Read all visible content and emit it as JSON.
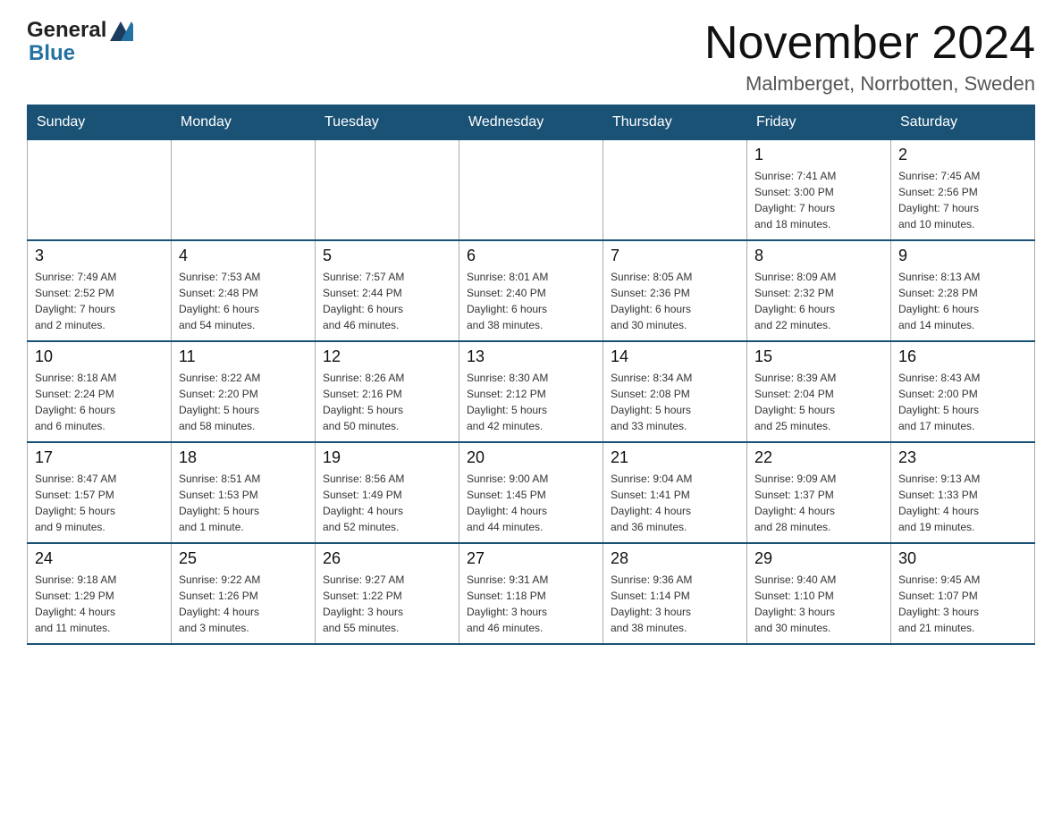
{
  "header": {
    "month_year": "November 2024",
    "location": "Malmberget, Norrbotten, Sweden",
    "logo_general": "General",
    "logo_blue": "Blue"
  },
  "weekdays": [
    "Sunday",
    "Monday",
    "Tuesday",
    "Wednesday",
    "Thursday",
    "Friday",
    "Saturday"
  ],
  "weeks": [
    {
      "days": [
        {
          "date": "",
          "info": ""
        },
        {
          "date": "",
          "info": ""
        },
        {
          "date": "",
          "info": ""
        },
        {
          "date": "",
          "info": ""
        },
        {
          "date": "",
          "info": ""
        },
        {
          "date": "1",
          "info": "Sunrise: 7:41 AM\nSunset: 3:00 PM\nDaylight: 7 hours\nand 18 minutes."
        },
        {
          "date": "2",
          "info": "Sunrise: 7:45 AM\nSunset: 2:56 PM\nDaylight: 7 hours\nand 10 minutes."
        }
      ]
    },
    {
      "days": [
        {
          "date": "3",
          "info": "Sunrise: 7:49 AM\nSunset: 2:52 PM\nDaylight: 7 hours\nand 2 minutes."
        },
        {
          "date": "4",
          "info": "Sunrise: 7:53 AM\nSunset: 2:48 PM\nDaylight: 6 hours\nand 54 minutes."
        },
        {
          "date": "5",
          "info": "Sunrise: 7:57 AM\nSunset: 2:44 PM\nDaylight: 6 hours\nand 46 minutes."
        },
        {
          "date": "6",
          "info": "Sunrise: 8:01 AM\nSunset: 2:40 PM\nDaylight: 6 hours\nand 38 minutes."
        },
        {
          "date": "7",
          "info": "Sunrise: 8:05 AM\nSunset: 2:36 PM\nDaylight: 6 hours\nand 30 minutes."
        },
        {
          "date": "8",
          "info": "Sunrise: 8:09 AM\nSunset: 2:32 PM\nDaylight: 6 hours\nand 22 minutes."
        },
        {
          "date": "9",
          "info": "Sunrise: 8:13 AM\nSunset: 2:28 PM\nDaylight: 6 hours\nand 14 minutes."
        }
      ]
    },
    {
      "days": [
        {
          "date": "10",
          "info": "Sunrise: 8:18 AM\nSunset: 2:24 PM\nDaylight: 6 hours\nand 6 minutes."
        },
        {
          "date": "11",
          "info": "Sunrise: 8:22 AM\nSunset: 2:20 PM\nDaylight: 5 hours\nand 58 minutes."
        },
        {
          "date": "12",
          "info": "Sunrise: 8:26 AM\nSunset: 2:16 PM\nDaylight: 5 hours\nand 50 minutes."
        },
        {
          "date": "13",
          "info": "Sunrise: 8:30 AM\nSunset: 2:12 PM\nDaylight: 5 hours\nand 42 minutes."
        },
        {
          "date": "14",
          "info": "Sunrise: 8:34 AM\nSunset: 2:08 PM\nDaylight: 5 hours\nand 33 minutes."
        },
        {
          "date": "15",
          "info": "Sunrise: 8:39 AM\nSunset: 2:04 PM\nDaylight: 5 hours\nand 25 minutes."
        },
        {
          "date": "16",
          "info": "Sunrise: 8:43 AM\nSunset: 2:00 PM\nDaylight: 5 hours\nand 17 minutes."
        }
      ]
    },
    {
      "days": [
        {
          "date": "17",
          "info": "Sunrise: 8:47 AM\nSunset: 1:57 PM\nDaylight: 5 hours\nand 9 minutes."
        },
        {
          "date": "18",
          "info": "Sunrise: 8:51 AM\nSunset: 1:53 PM\nDaylight: 5 hours\nand 1 minute."
        },
        {
          "date": "19",
          "info": "Sunrise: 8:56 AM\nSunset: 1:49 PM\nDaylight: 4 hours\nand 52 minutes."
        },
        {
          "date": "20",
          "info": "Sunrise: 9:00 AM\nSunset: 1:45 PM\nDaylight: 4 hours\nand 44 minutes."
        },
        {
          "date": "21",
          "info": "Sunrise: 9:04 AM\nSunset: 1:41 PM\nDaylight: 4 hours\nand 36 minutes."
        },
        {
          "date": "22",
          "info": "Sunrise: 9:09 AM\nSunset: 1:37 PM\nDaylight: 4 hours\nand 28 minutes."
        },
        {
          "date": "23",
          "info": "Sunrise: 9:13 AM\nSunset: 1:33 PM\nDaylight: 4 hours\nand 19 minutes."
        }
      ]
    },
    {
      "days": [
        {
          "date": "24",
          "info": "Sunrise: 9:18 AM\nSunset: 1:29 PM\nDaylight: 4 hours\nand 11 minutes."
        },
        {
          "date": "25",
          "info": "Sunrise: 9:22 AM\nSunset: 1:26 PM\nDaylight: 4 hours\nand 3 minutes."
        },
        {
          "date": "26",
          "info": "Sunrise: 9:27 AM\nSunset: 1:22 PM\nDaylight: 3 hours\nand 55 minutes."
        },
        {
          "date": "27",
          "info": "Sunrise: 9:31 AM\nSunset: 1:18 PM\nDaylight: 3 hours\nand 46 minutes."
        },
        {
          "date": "28",
          "info": "Sunrise: 9:36 AM\nSunset: 1:14 PM\nDaylight: 3 hours\nand 38 minutes."
        },
        {
          "date": "29",
          "info": "Sunrise: 9:40 AM\nSunset: 1:10 PM\nDaylight: 3 hours\nand 30 minutes."
        },
        {
          "date": "30",
          "info": "Sunrise: 9:45 AM\nSunset: 1:07 PM\nDaylight: 3 hours\nand 21 minutes."
        }
      ]
    }
  ]
}
